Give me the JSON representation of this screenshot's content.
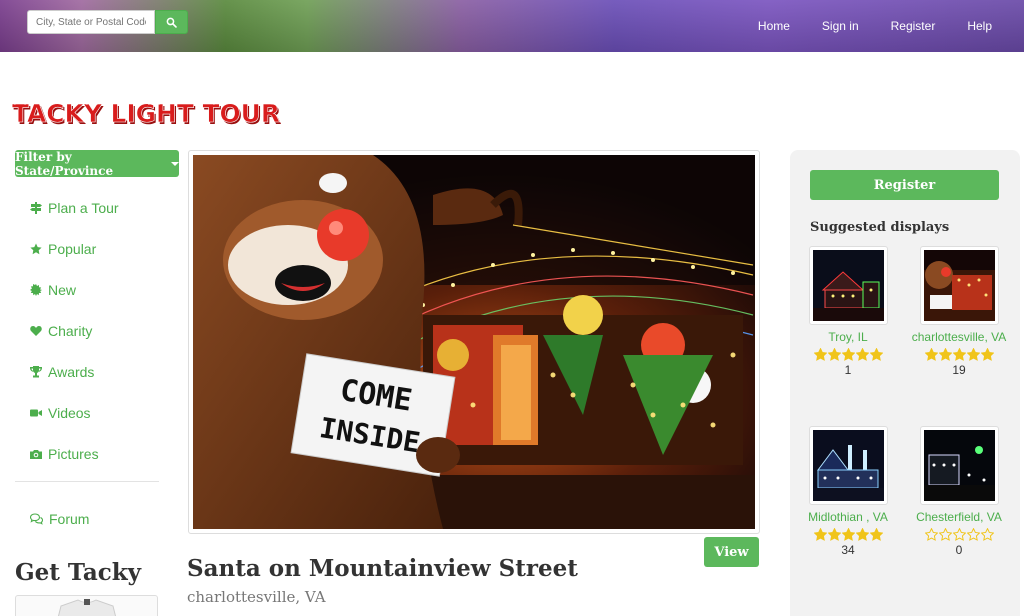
{
  "header": {
    "search_placeholder": "City, State or Postal Code",
    "nav": [
      "Home",
      "Sign in",
      "Register",
      "Help"
    ]
  },
  "logo_text": "TACKY LIGHT TOUR",
  "sidebar": {
    "filter_label": "Filter by State/Province",
    "items": [
      {
        "label": "Plan a Tour",
        "icon": "signpost-icon"
      },
      {
        "label": "Popular",
        "icon": "star-icon"
      },
      {
        "label": "New",
        "icon": "burst-icon"
      },
      {
        "label": "Charity",
        "icon": "heart-icon"
      },
      {
        "label": "Awards",
        "icon": "trophy-icon"
      },
      {
        "label": "Videos",
        "icon": "video-camera-icon"
      },
      {
        "label": "Pictures",
        "icon": "camera-icon"
      }
    ],
    "forum_label": "Forum",
    "get_tacky": "Get Tacky"
  },
  "main": {
    "view_label": "View",
    "title": "Santa on Mountainview Street",
    "location": "charlottesville, VA",
    "sign_text_1": "COME",
    "sign_text_2": "INSIDE"
  },
  "right": {
    "register_label": "Register",
    "suggested_title": "Suggested displays",
    "suggestions": [
      {
        "location": "Troy, IL",
        "rating": 5,
        "count": "1"
      },
      {
        "location": "charlottesville, VA",
        "rating": 5,
        "count": "19"
      },
      {
        "location": "Midlothian , VA",
        "rating": 5,
        "count": "34"
      },
      {
        "location": "Chesterfield, VA",
        "rating": 0,
        "count": "0"
      }
    ]
  },
  "colors": {
    "accent": "#5cb85c",
    "link": "#4cae4c",
    "star": "#f0c419",
    "logo_red": "#d91c1c"
  }
}
